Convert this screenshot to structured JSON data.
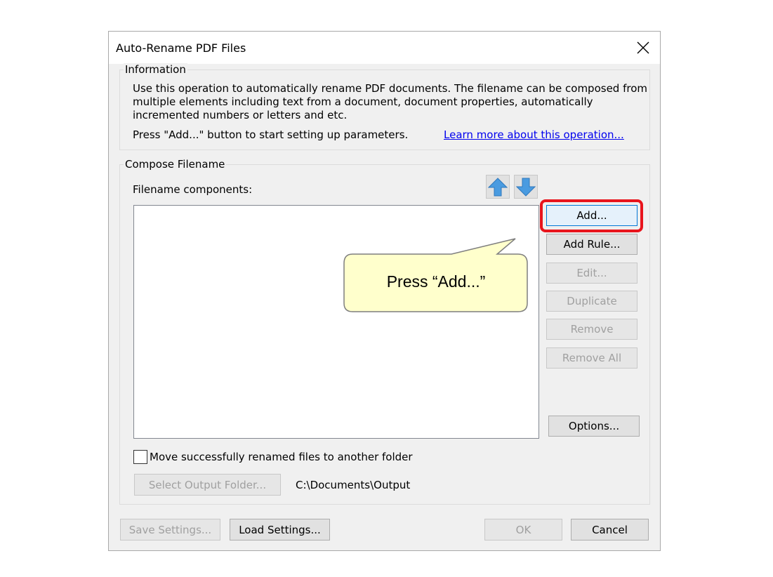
{
  "dialog": {
    "title": "Auto-Rename PDF Files"
  },
  "information": {
    "legend": "Information",
    "description_lines": [
      "Use this operation to automatically rename PDF documents. The filename can be composed from",
      "multiple elements including text from a document, document properties, automatically",
      "incremented numbers or letters and etc."
    ],
    "hint": "Press \"Add...\" button to start setting up parameters.",
    "learn_more_link": "Learn more about this operation..."
  },
  "compose": {
    "legend": "Compose Filename",
    "components_label": "Filename components:",
    "components": [],
    "buttons": {
      "add": "Add...",
      "add_rule": "Add Rule...",
      "edit": "Edit...",
      "duplicate": "Duplicate",
      "remove": "Remove",
      "remove_all": "Remove All",
      "options": "Options..."
    },
    "move_files_label": "Move successfully renamed files to another folder",
    "move_files_checked": false,
    "select_output_folder": "Select Output Folder...",
    "output_folder_path": "C:\\Documents\\Output"
  },
  "footer": {
    "save_settings": "Save Settings...",
    "load_settings": "Load Settings...",
    "ok": "OK",
    "cancel": "Cancel"
  },
  "callout": {
    "text": "Press “Add...”"
  },
  "colors": {
    "highlight": "#e8141c",
    "callout_fill": "#ffffcc",
    "arrow_blue": "#4a9be0",
    "link": "#0000ee"
  },
  "icons": {
    "close": "close-icon",
    "move_up": "arrow-up-icon",
    "move_down": "arrow-down-icon"
  }
}
